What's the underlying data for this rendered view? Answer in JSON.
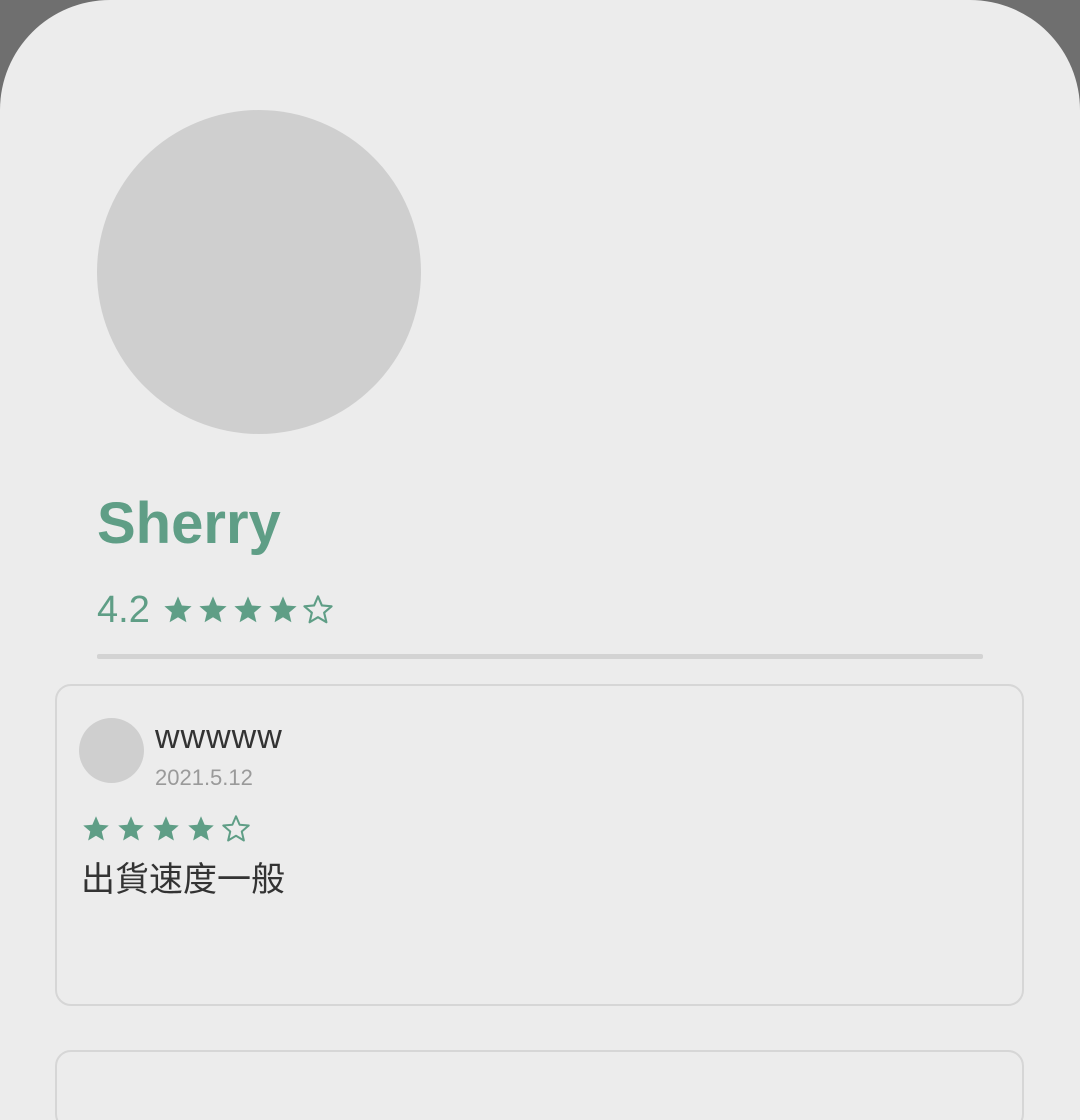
{
  "profile": {
    "name": "Sherry",
    "rating_value": "4.2",
    "rating_stars": 4.2
  },
  "reviews": [
    {
      "reviewer": "wwwww",
      "date": "2021.5.12",
      "stars": 4,
      "text": "出貨速度一般"
    }
  ],
  "colors": {
    "accent": "#5f9e86",
    "background": "#ececec",
    "placeholder": "#cfcfcf",
    "divider": "#d3d3d3"
  },
  "icons": {
    "filled_star": "star-icon",
    "empty_star": "star-outline-icon"
  }
}
